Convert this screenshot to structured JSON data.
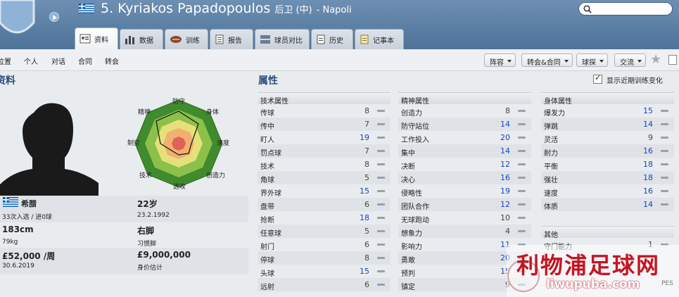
{
  "header": {
    "player_number_name": "5. Kyriakos Papadopoulos",
    "position": "后卫 (中)",
    "club": "Napoli",
    "flag_colors": [
      "#0d5eaf",
      "#ffffff"
    ]
  },
  "tabs": [
    {
      "label": "资料",
      "icon": "profile-icon",
      "active": true
    },
    {
      "label": "数据",
      "icon": "stats-icon"
    },
    {
      "label": "训练",
      "icon": "ball-icon"
    },
    {
      "label": "报告",
      "icon": "report-icon"
    },
    {
      "label": "球员对比",
      "icon": "compare-icon"
    },
    {
      "label": "历史",
      "icon": "history-icon"
    },
    {
      "label": "记事本",
      "icon": "notebook-icon"
    }
  ],
  "subnav": {
    "items": [
      "位置",
      "个人",
      "对话",
      "合同",
      "转会"
    ],
    "dropdowns": [
      "阵容",
      "转会&合同",
      "球探",
      "交流"
    ]
  },
  "profile": {
    "title": "资料",
    "nationality": "希腊",
    "caps": "33次入选 / 进0球",
    "age": "22岁",
    "dob": "23.2.1992",
    "height": "183cm",
    "weight": "79kg",
    "foot": "右脚",
    "foot_label": "习惯脚",
    "wage": "£52,000 /周",
    "contract_end": "30.6.2019",
    "value": "£9,000,000",
    "value_label": "身价估计"
  },
  "radar_labels": [
    "防守",
    "身体",
    "速度",
    "创造力",
    "进攻",
    "技术",
    "制空",
    "精神"
  ],
  "attributes": {
    "title": "属性",
    "show_training_label": "显示近期训练变化",
    "technical": {
      "title": "技术属性",
      "rows": [
        {
          "name": "传球",
          "value": "8"
        },
        {
          "name": "传中",
          "value": "7"
        },
        {
          "name": "盯人",
          "value": "19"
        },
        {
          "name": "罚点球",
          "value": "7"
        },
        {
          "name": "技术",
          "value": "8"
        },
        {
          "name": "角球",
          "value": "5"
        },
        {
          "name": "界外球",
          "value": "15"
        },
        {
          "name": "盘带",
          "value": "6"
        },
        {
          "name": "抢断",
          "value": "18"
        },
        {
          "name": "任意球",
          "value": "5"
        },
        {
          "name": "射门",
          "value": "6"
        },
        {
          "name": "停球",
          "value": "8"
        },
        {
          "name": "头球",
          "value": "15"
        },
        {
          "name": "远射",
          "value": "6"
        }
      ]
    },
    "mental": {
      "title": "精神属性",
      "rows": [
        {
          "name": "创造力",
          "value": "8"
        },
        {
          "name": "防守站位",
          "value": "14"
        },
        {
          "name": "工作投入",
          "value": "20"
        },
        {
          "name": "集中",
          "value": "14"
        },
        {
          "name": "决断",
          "value": "12"
        },
        {
          "name": "决心",
          "value": "16"
        },
        {
          "name": "侵略性",
          "value": "19"
        },
        {
          "name": "团队合作",
          "value": "12"
        },
        {
          "name": "无球跑动",
          "value": "10"
        },
        {
          "name": "想象力",
          "value": "4"
        },
        {
          "name": "影响力",
          "value": "11"
        },
        {
          "name": "勇敢",
          "value": "20"
        },
        {
          "name": "预判",
          "value": "15"
        },
        {
          "name": "镇定",
          "value": "9"
        }
      ]
    },
    "physical": {
      "title": "身体属性",
      "rows": [
        {
          "name": "爆发力",
          "value": "15"
        },
        {
          "name": "弹跳",
          "value": "14"
        },
        {
          "name": "灵活",
          "value": "9"
        },
        {
          "name": "耐力",
          "value": "16"
        },
        {
          "name": "平衡",
          "value": "18"
        },
        {
          "name": "强壮",
          "value": "18"
        },
        {
          "name": "速度",
          "value": "16"
        },
        {
          "name": "体质",
          "value": "14"
        }
      ]
    },
    "other": {
      "title": "其他",
      "rows": [
        {
          "name": "守门能力",
          "value": "1"
        }
      ]
    }
  },
  "watermark": {
    "text": "利物浦足球网",
    "url": "liwupuba.com",
    "pes": "PES"
  }
}
